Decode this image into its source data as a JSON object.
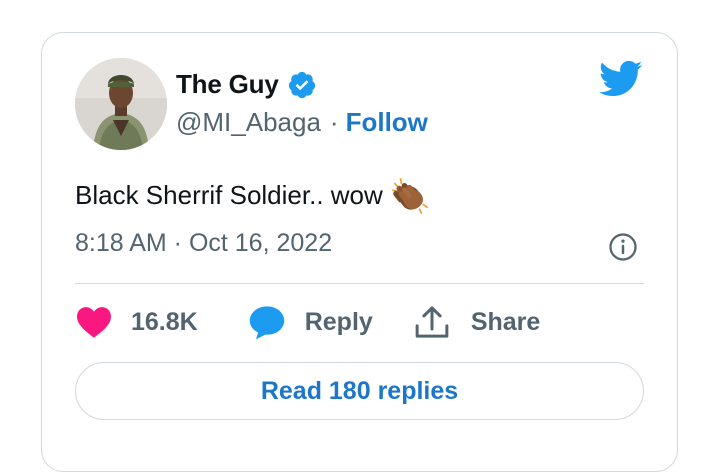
{
  "tweet": {
    "author": {
      "display_name": "The Guy",
      "handle": "@MI_Abaga",
      "verified": true,
      "avatar": "avatar-photo"
    },
    "separator": "·",
    "follow_label": "Follow",
    "text": "Black Sherrif Soldier.. wow",
    "emoji": "clapping-hands-medium-dark-skin-tone",
    "timestamp": "8:18 AM · Oct 16, 2022",
    "actions": {
      "like_count": "16.8K",
      "reply_label": "Reply",
      "share_label": "Share"
    },
    "read_replies_label": "Read 180 replies"
  },
  "icons": {
    "brand": "twitter-bird-icon",
    "verified": "verified-badge-icon",
    "info": "info-icon",
    "like": "heart-icon",
    "reply": "speech-bubble-icon",
    "share": "share-upload-icon"
  },
  "colors": {
    "brand_blue": "#1d9bf0",
    "link_blue": "#1d77c8",
    "like_pink": "#f91880",
    "text_primary": "#0f1419",
    "text_secondary": "#536471",
    "border": "#cfd9de"
  }
}
